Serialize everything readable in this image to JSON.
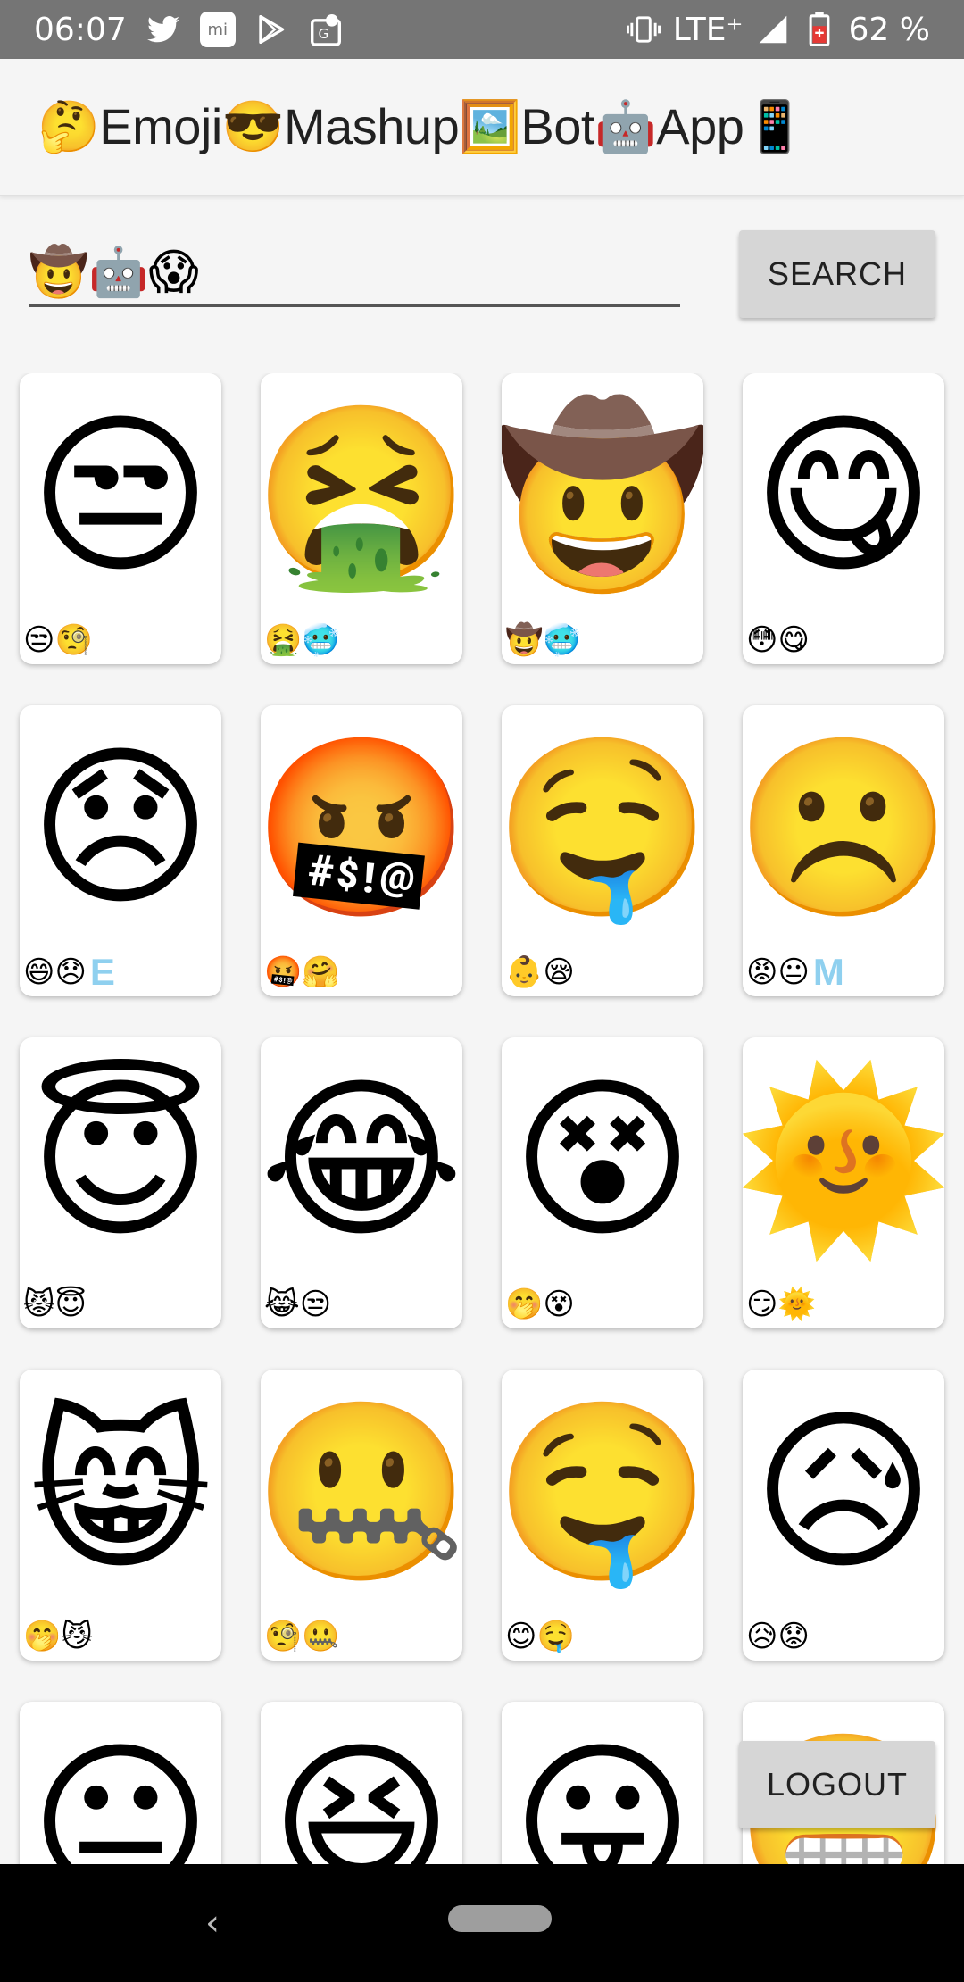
{
  "status_bar": {
    "time": "06:07",
    "network": "LTE⁺",
    "battery": "62 %"
  },
  "app_bar": {
    "title": "🤔Emoji😎Mashup🖼️Bot🤖App📱"
  },
  "search": {
    "value": "🤠🤖😱",
    "button_label": "SEARCH"
  },
  "cards": [
    {
      "image": "😒",
      "tags": "😒🧐",
      "letter": ""
    },
    {
      "image": "🤮",
      "tags": "🤮🥶",
      "letter": ""
    },
    {
      "image": "🤠",
      "tags": "🤠🥶",
      "letter": ""
    },
    {
      "image": "😋",
      "tags": "😳😋",
      "letter": ""
    },
    {
      "image": "😞",
      "tags": "😄😞",
      "letter": "E"
    },
    {
      "image": "🤬",
      "tags": "🤬🤗",
      "letter": ""
    },
    {
      "image": "🤤",
      "tags": "👶😪",
      "letter": ""
    },
    {
      "image": "☹️",
      "tags": "😡😐",
      "letter": "M"
    },
    {
      "image": "😇",
      "tags": "😾😇",
      "letter": ""
    },
    {
      "image": "😂",
      "tags": "😹😒",
      "letter": ""
    },
    {
      "image": "😵",
      "tags": "🤭😵",
      "letter": ""
    },
    {
      "image": "🌞",
      "tags": "😏🌞",
      "letter": ""
    },
    {
      "image": "😸",
      "tags": "🤭😼",
      "letter": ""
    },
    {
      "image": "🤐",
      "tags": "🧐🤐",
      "letter": ""
    },
    {
      "image": "🤤",
      "tags": "😊🤤",
      "letter": ""
    },
    {
      "image": "😥",
      "tags": "😥😟",
      "letter": ""
    },
    {
      "image": "😐",
      "tags": "",
      "letter": ""
    },
    {
      "image": "😆",
      "tags": "",
      "letter": ""
    },
    {
      "image": "😛",
      "tags": "",
      "letter": ""
    },
    {
      "image": "😬",
      "tags": "",
      "letter": ""
    }
  ],
  "logout_label": "LOGOUT"
}
